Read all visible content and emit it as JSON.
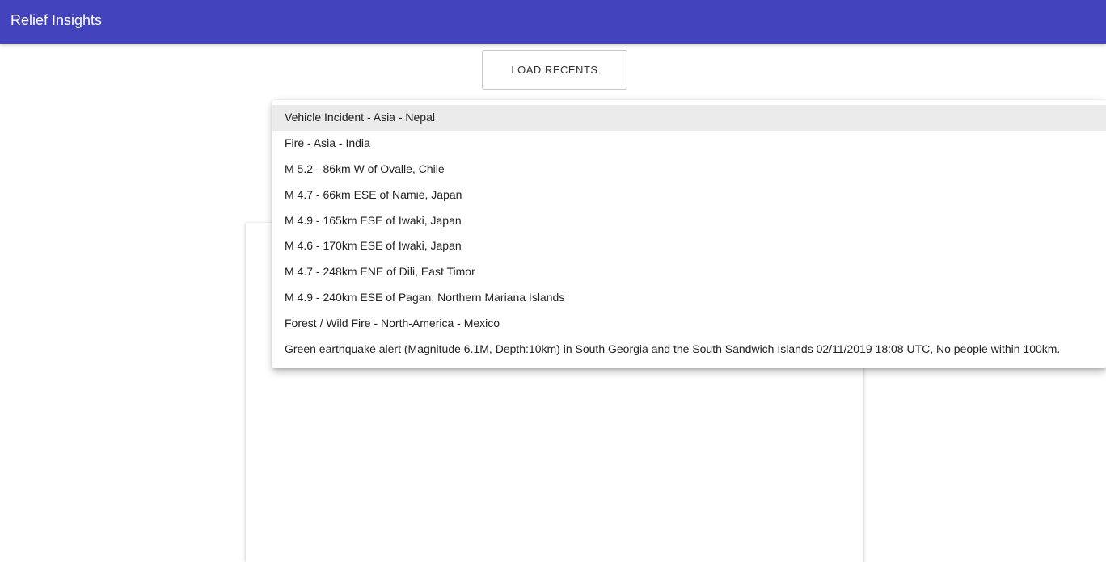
{
  "app_bar": {
    "title": "Relief Insights"
  },
  "toolbar": {
    "load_recents_label": "LOAD RECENTS"
  },
  "dropdown": {
    "highlighted_index": 0,
    "items": [
      "Vehicle Incident - Asia - Nepal",
      "Fire - Asia - India",
      "M 5.2 - 86km W of Ovalle, Chile",
      "M 4.7 - 66km ESE of Namie, Japan",
      "M 4.9 - 165km ESE of Iwaki, Japan",
      "M 4.6 - 170km ESE of Iwaki, Japan",
      "M 4.7 - 248km ENE of Dili, East Timor",
      "M 4.9 - 240km ESE of Pagan, Northern Mariana Islands",
      "Forest / Wild Fire - North-America - Mexico",
      "Green earthquake alert (Magnitude 6.1M, Depth:10km) in South Georgia and the South Sandwich Islands 02/11/2019 18:08 UTC, No people within 100km."
    ]
  },
  "colors": {
    "app_bar": "#4343bd",
    "highlight": "#ebebeb"
  }
}
